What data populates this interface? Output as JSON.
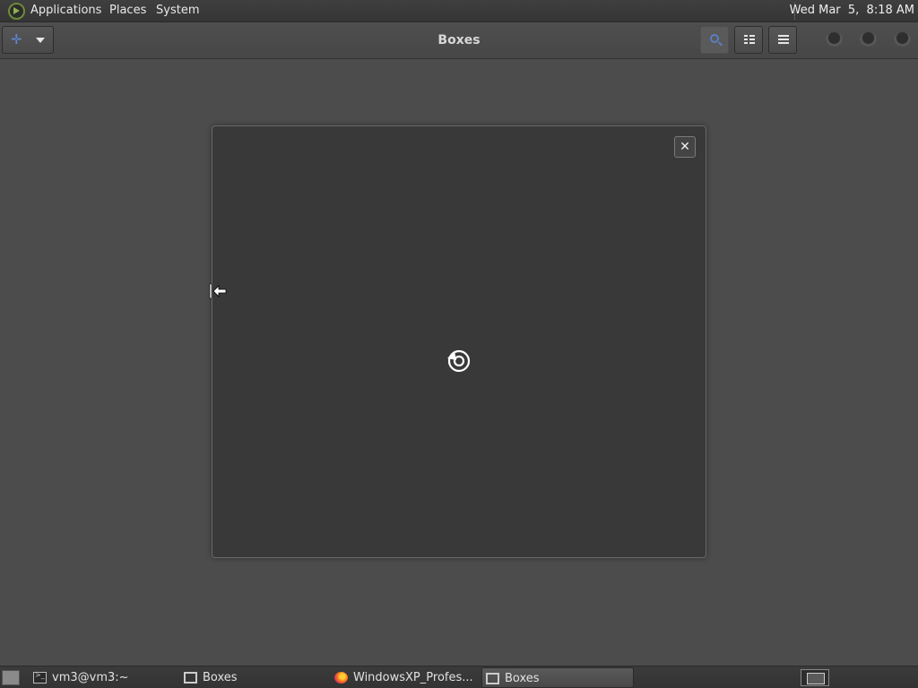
{
  "top_panel": {
    "menus": [
      "Applications",
      "Places",
      "System"
    ],
    "clock": "Wed Mar  5,  8:18 AM"
  },
  "headerbar": {
    "title": "Boxes",
    "new_icon": "plus-icon",
    "search_icon": "search-icon",
    "list_icon": "list-view-icon",
    "menu_icon": "hamburger-menu-icon"
  },
  "dialog": {
    "close_label": "✕",
    "spinner_icon": "loading-spinner-icon"
  },
  "taskbar": {
    "tasks": [
      {
        "label": "vm3@vm3:~",
        "icon": "terminal-icon"
      },
      {
        "label": "Boxes",
        "icon": "boxes-icon"
      },
      {
        "label": "WindowsXP_Profes...",
        "icon": "firefox-icon"
      },
      {
        "label": "Boxes",
        "icon": "boxes-icon",
        "active": true
      }
    ]
  },
  "colors": {
    "accent_blue": "#5c8ce0",
    "background": "#4c4c4c",
    "dialog": "#393939"
  }
}
